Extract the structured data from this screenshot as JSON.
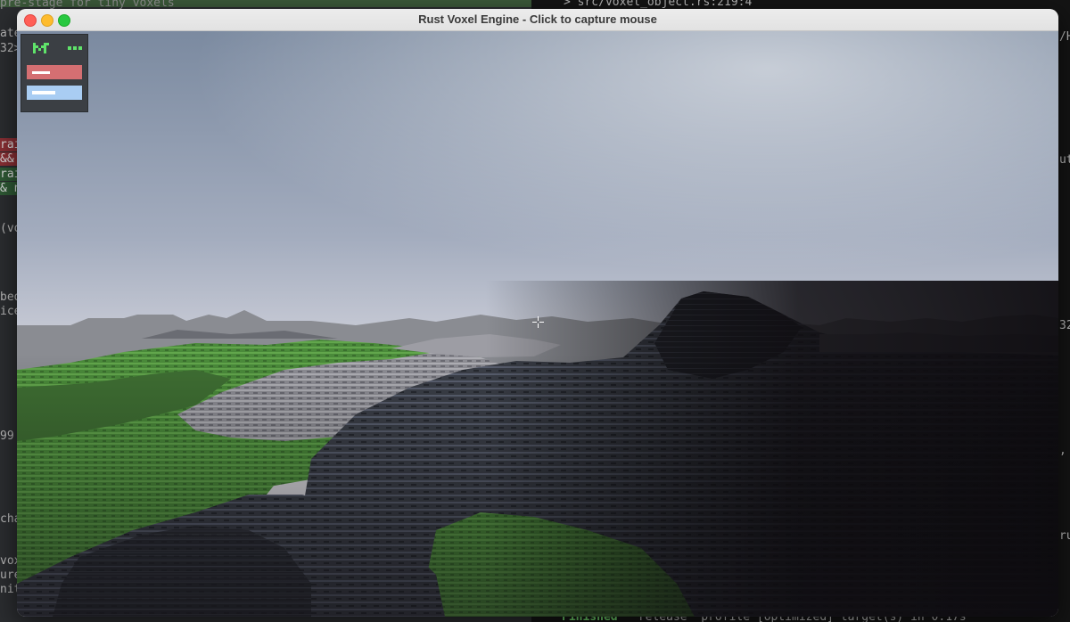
{
  "window": {
    "title": "Rust Voxel Engine - Click to capture mouse"
  },
  "background_left": {
    "fragments": [
      "pre-stage for tiny voxels",
      "ate",
      "32>",
      "rai",
      "&&",
      "rai",
      "& n",
      "(vo",
      "bed",
      "ice",
      "99",
      "cha",
      "vox",
      "ure",
      "nit"
    ]
  },
  "background_right": {
    "fragments": [
      "> src/voxel_object.rs:219:4",
      "/H",
      "ut",
      "32",
      ",",
      "ru",
      "r"
    ],
    "build_status": "Finished",
    "build_detail": "`release` profile [optimized] target(s) in 0.17s"
  },
  "hud": {
    "logo_icon": "voxel-logo-icon",
    "colors": {
      "panel": "#3b3f44",
      "red_bar": "#d46f72",
      "blue_bar": "#a9cdf3",
      "logo": "#5fe36a"
    }
  }
}
